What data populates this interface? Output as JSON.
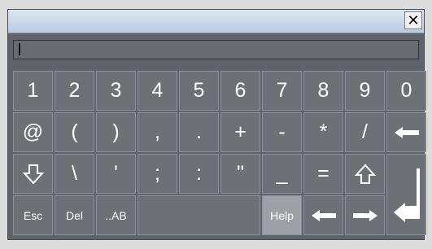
{
  "window": {
    "close_label": "✕"
  },
  "input": {
    "value": ""
  },
  "keys": {
    "row1": [
      "1",
      "2",
      "3",
      "4",
      "5",
      "6",
      "7",
      "8",
      "9",
      "0"
    ],
    "row2": [
      "@",
      "(",
      ")",
      ",",
      ".",
      "+",
      "-",
      "*",
      "/"
    ],
    "row3": [
      "\\",
      "'",
      ";",
      ":",
      "\"",
      "_",
      "="
    ],
    "row4": {
      "esc": "Esc",
      "del": "Del",
      "ab": "..AB",
      "help": "Help"
    }
  },
  "icons": {
    "backspace": "arrow-left-icon",
    "shift_down": "shift-down-outline-icon",
    "shift_up": "shift-up-outline-icon",
    "left": "arrow-left-icon",
    "right": "arrow-right-icon",
    "enter": "enter-icon"
  }
}
